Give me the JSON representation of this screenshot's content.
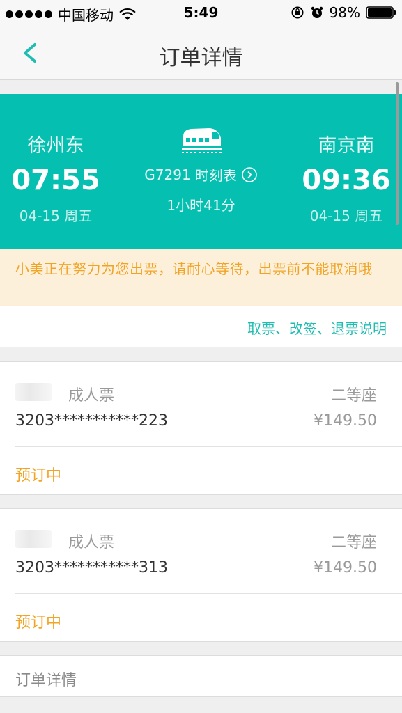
{
  "status_bar": {
    "carrier": "中国移动",
    "time": "5:49",
    "battery": "98%"
  },
  "nav": {
    "title": "订单详情"
  },
  "trip": {
    "from": {
      "station": "徐州东",
      "time": "07:55",
      "date": "04-15 周五"
    },
    "to": {
      "station": "南京南",
      "time": "09:36",
      "date": "04-15 周五"
    },
    "train_no": "G7291",
    "timetable_label": "时刻表",
    "duration": "1小时41分"
  },
  "notice": {
    "text": "小美正在努力为您出票，请耐心等待，出票前不能取消哦"
  },
  "policy": {
    "link_text": "取票、改签、退票说明"
  },
  "passengers": [
    {
      "ticket_type": "成人票",
      "seat_class": "二等座",
      "id_number": "3203***********223",
      "price": "¥149.50",
      "status": "预订中"
    },
    {
      "ticket_type": "成人票",
      "seat_class": "二等座",
      "id_number": "3203***********313",
      "price": "¥149.50",
      "status": "预订中"
    }
  ],
  "order": {
    "label": "订单详情"
  },
  "colors": {
    "brand_teal": "#05c0b1",
    "notice_bg": "#fdf0db",
    "accent_orange": "#f1a424",
    "link_teal": "#1ebdb1"
  }
}
